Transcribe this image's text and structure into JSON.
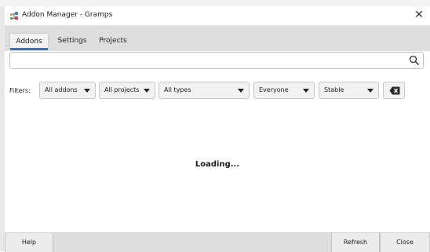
{
  "window": {
    "title": "Addon Manager - Gramps"
  },
  "tabs": [
    {
      "label": "Addons",
      "active": true
    },
    {
      "label": "Settings",
      "active": false
    },
    {
      "label": "Projects",
      "active": false
    }
  ],
  "search": {
    "value": "",
    "placeholder": ""
  },
  "filters": {
    "label": "Filters:",
    "addons": "All addons",
    "projects": "All projects",
    "types": "All types",
    "audience": "Everyone",
    "status": "Stable"
  },
  "status_text": "Loading...",
  "buttons": {
    "help": "Help",
    "refresh": "Refresh",
    "close": "Close"
  },
  "colors": {
    "accent": "#2f74c0",
    "tabbar_bg": "#dedede"
  },
  "icons": {
    "app": "gramps-tree-icon",
    "close": "close-icon",
    "search": "search-icon",
    "clear": "backspace-clear-icon",
    "dropdown": "chevron-down-icon"
  }
}
